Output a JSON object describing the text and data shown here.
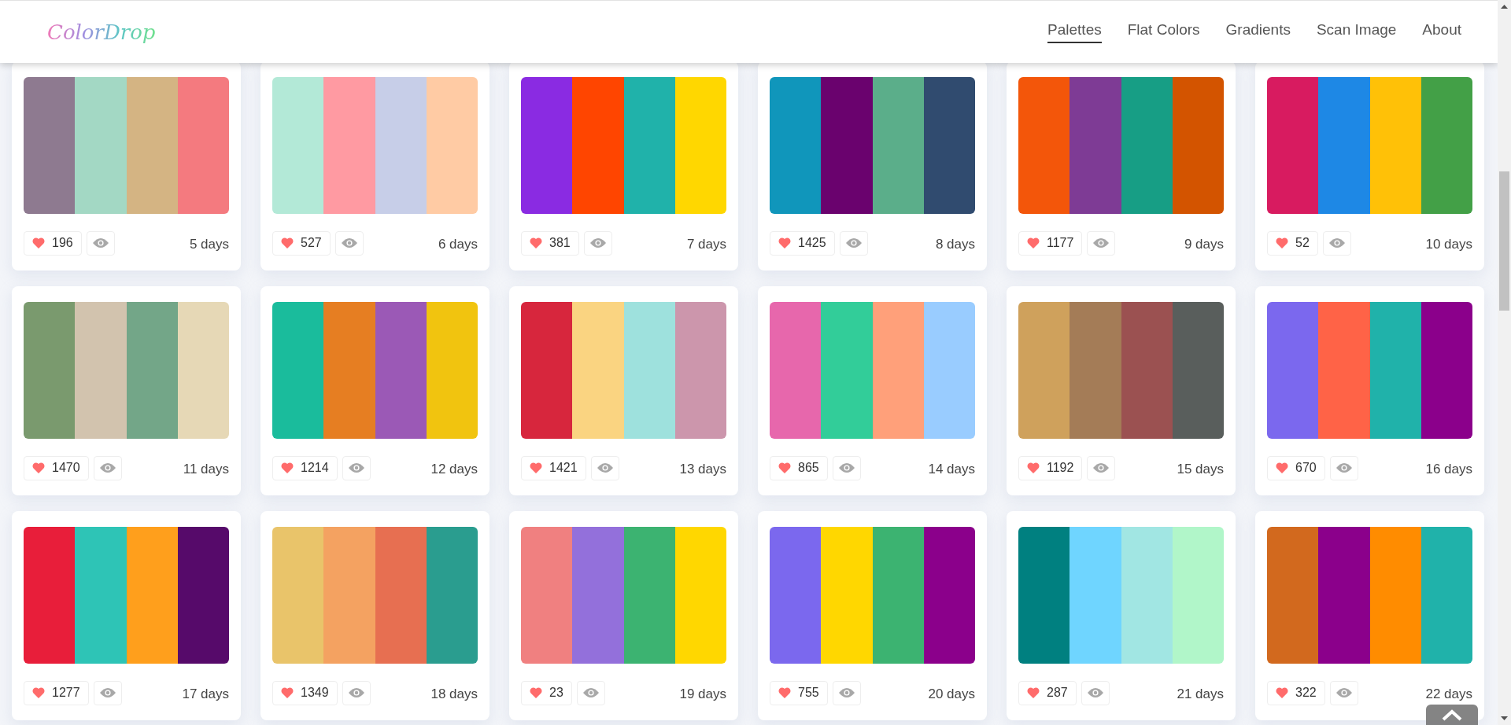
{
  "logo": "ColorDrop",
  "nav": [
    {
      "label": "Palettes",
      "selected": true
    },
    {
      "label": "Flat Colors",
      "selected": false
    },
    {
      "label": "Gradients",
      "selected": false
    },
    {
      "label": "Scan Image",
      "selected": false
    },
    {
      "label": "About",
      "selected": false
    }
  ],
  "palettes": [
    {
      "swatches": [
        {
          "color": "#8e7a90"
        },
        {
          "color": "#a3d8c4"
        },
        {
          "color": "#d4b483"
        },
        {
          "color": "#f47a7f"
        }
      ],
      "likes": "196",
      "age": "5 days"
    },
    {
      "swatches": [
        {
          "color": "#b3e9d7"
        },
        {
          "color": "#ff9aa2"
        },
        {
          "color": "#c7cee8"
        },
        {
          "color": "#ffcba4"
        }
      ],
      "likes": "527",
      "age": "6 days"
    },
    {
      "swatches": [
        {
          "color": "#8a2be2"
        },
        {
          "color": "#ff4500"
        },
        {
          "color": "#20b2aa"
        },
        {
          "color": "#ffd700"
        }
      ],
      "likes": "381",
      "age": "7 days"
    },
    {
      "swatches": [
        {
          "color": "#1096bb"
        },
        {
          "color": "#6a026e"
        },
        {
          "color": "#5bae8a"
        },
        {
          "color": "#304b6f"
        }
      ],
      "likes": "1425",
      "age": "8 days"
    },
    {
      "swatches": [
        {
          "color": "#f3560a"
        },
        {
          "color": "#7e3b95"
        },
        {
          "color": "#179e85"
        },
        {
          "color": "#d35400"
        }
      ],
      "likes": "1177",
      "age": "9 days"
    },
    {
      "swatches": [
        {
          "color": "#d81b60"
        },
        {
          "color": "#1e88e5"
        },
        {
          "color": "#ffc107"
        },
        {
          "color": "#43a047"
        }
      ],
      "likes": "52",
      "age": "10 days"
    },
    {
      "swatches": [
        {
          "color": "#7a9a6e"
        },
        {
          "color": "#d2c3ae"
        },
        {
          "color": "#73a688"
        },
        {
          "color": "#e6d8b6"
        }
      ],
      "likes": "1470",
      "age": "11 days"
    },
    {
      "swatches": [
        {
          "color": "#1abc9c"
        },
        {
          "color": "#e67e22"
        },
        {
          "color": "#9b59b6"
        },
        {
          "color": "#f1c40f"
        }
      ],
      "likes": "1214",
      "age": "12 days"
    },
    {
      "swatches": [
        {
          "color": "#d7263d"
        },
        {
          "color": "#fad481"
        },
        {
          "color": "#9ee1dd"
        },
        {
          "color": "#cc96ac"
        }
      ],
      "likes": "1421",
      "age": "13 days"
    },
    {
      "swatches": [
        {
          "color": "#e767ac"
        },
        {
          "color": "#32cd99"
        },
        {
          "color": "#ffa07a"
        },
        {
          "color": "#99ccff"
        }
      ],
      "likes": "865",
      "age": "14 days"
    },
    {
      "swatches": [
        {
          "color": "#cfa15c"
        },
        {
          "color": "#a47c57"
        },
        {
          "color": "#9b5151"
        },
        {
          "color": "#595e5c"
        }
      ],
      "likes": "1192",
      "age": "15 days"
    },
    {
      "swatches": [
        {
          "color": "#7b68ee"
        },
        {
          "color": "#ff6347"
        },
        {
          "color": "#20b2aa"
        },
        {
          "color": "#8b008b"
        }
      ],
      "likes": "670",
      "age": "16 days"
    },
    {
      "swatches": [
        {
          "color": "#e81e3a"
        },
        {
          "color": "#2ec4b6"
        },
        {
          "color": "#ff9f1c"
        },
        {
          "color": "#560a6a"
        }
      ],
      "likes": "1277",
      "age": "17 days"
    },
    {
      "swatches": [
        {
          "color": "#e9c46a"
        },
        {
          "color": "#f4a261"
        },
        {
          "color": "#e76f51"
        },
        {
          "color": "#2a9d8f"
        }
      ],
      "likes": "1349",
      "age": "18 days"
    },
    {
      "swatches": [
        {
          "color": "#f08080"
        },
        {
          "color": "#9370db"
        },
        {
          "color": "#3cb371"
        },
        {
          "color": "#ffd700"
        }
      ],
      "likes": "23",
      "age": "19 days"
    },
    {
      "swatches": [
        {
          "color": "#7b68ee"
        },
        {
          "color": "#ffd700"
        },
        {
          "color": "#3cb371"
        },
        {
          "color": "#8b008b"
        }
      ],
      "likes": "755",
      "age": "20 days"
    },
    {
      "swatches": [
        {
          "color": "#008080"
        },
        {
          "color": "#6fd5ff"
        },
        {
          "color": "#a1e6e3"
        },
        {
          "color": "#b1f6c9"
        }
      ],
      "likes": "287",
      "age": "21 days"
    },
    {
      "swatches": [
        {
          "color": "#d2691e"
        },
        {
          "color": "#8b008b"
        },
        {
          "color": "#ff8c00"
        },
        {
          "color": "#20b2aa"
        }
      ],
      "likes": "322",
      "age": "22 days"
    }
  ]
}
